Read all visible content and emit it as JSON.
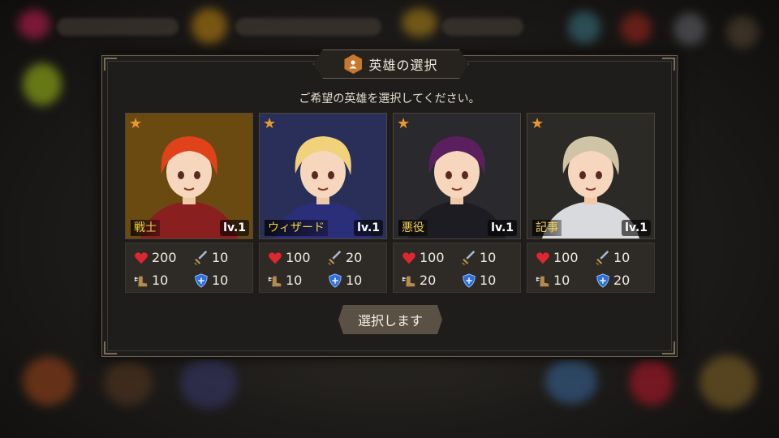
{
  "dialog": {
    "title": "英雄の選択",
    "subtitle": "ご希望の英雄を選択してください。",
    "confirm_label": "選択します"
  },
  "heroes": [
    {
      "name": "戦士",
      "level": "lv.1",
      "stars": "★",
      "hp": "200",
      "attack": "10",
      "speed": "10",
      "defense": "10",
      "hair_color": "#e0421a",
      "bg_color": "#6b4a12",
      "outfit_color": "#8a1f1f"
    },
    {
      "name": "ウィザード",
      "level": "lv.1",
      "stars": "★",
      "hp": "100",
      "attack": "20",
      "speed": "10",
      "defense": "10",
      "hair_color": "#f1d27a",
      "bg_color": "#2a2f5a",
      "outfit_color": "#2b2f7a"
    },
    {
      "name": "悪役",
      "level": "lv.1",
      "stars": "★",
      "hp": "100",
      "attack": "10",
      "speed": "20",
      "defense": "10",
      "hair_color": "#5a1f5e",
      "bg_color": "#2a2a2e",
      "outfit_color": "#1c1c22"
    },
    {
      "name": "記事",
      "level": "lv.1",
      "stars": "★",
      "hp": "100",
      "attack": "10",
      "speed": "10",
      "defense": "20",
      "hair_color": "#cfc4a6",
      "bg_color": "#2c2a26",
      "outfit_color": "#d9dade"
    }
  ],
  "icons": {
    "title": "hero-badge-icon",
    "star": "star-icon",
    "hp": "heart-icon",
    "attack": "sword-icon",
    "speed": "winged-boot-icon",
    "defense": "shield-icon"
  },
  "colors": {
    "accent": "#c9782b",
    "name_text": "#f4d24a",
    "hp": "#e0262e",
    "attack": "#8fa4c8",
    "defense": "#2f6fd6"
  }
}
